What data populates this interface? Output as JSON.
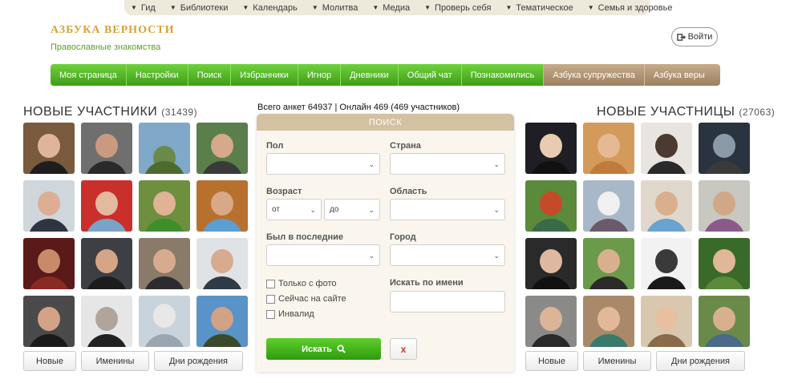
{
  "portal": {
    "items": [
      {
        "label": "Гид"
      },
      {
        "label": "Библиотеки"
      },
      {
        "label": "Календарь"
      },
      {
        "label": "Молитва"
      },
      {
        "label": "Медиа"
      },
      {
        "label": "Проверь себя"
      },
      {
        "label": "Тематическое"
      },
      {
        "label": "Семья и здоровье"
      }
    ]
  },
  "header": {
    "logo_title": "АЗБУКА ВЕРНОСТИ",
    "logo_subtitle": "Православные знакомства",
    "login_label": "Войти"
  },
  "nav": {
    "items": [
      {
        "label": "Моя страница"
      },
      {
        "label": "Настройки"
      },
      {
        "label": "Поиск"
      },
      {
        "label": "Избранники"
      },
      {
        "label": "Игнор"
      },
      {
        "label": "Дневники"
      },
      {
        "label": "Общий чат"
      },
      {
        "label": "Познакомились"
      },
      {
        "label": "Азбука супружества"
      },
      {
        "label": "Азбука веры"
      }
    ]
  },
  "men": {
    "title": "НОВЫЕ УЧАСТНИКИ",
    "count": "(31439)",
    "tabs": [
      "Новые",
      "Именины",
      "Дни рождения"
    ]
  },
  "women": {
    "title": "НОВЫЕ УЧАСТНИЦЫ",
    "count": "(27063)",
    "tabs": [
      "Новые",
      "Именины",
      "Дни рождения"
    ]
  },
  "stats": "Всего анкет 64937 | Онлайн 469 (469 участников)",
  "search": {
    "title": "ПОИСК",
    "gender_label": "Пол",
    "country_label": "Страна",
    "age_label": "Возраст",
    "age_from": "от",
    "age_to": "до",
    "region_label": "Область",
    "last_seen_label": "Был в последние",
    "city_label": "Город",
    "name_label": "Искать по имени",
    "checkboxes": [
      "Только с фото",
      "Сейчас на сайте",
      "Инвалид"
    ],
    "find_label": "Искать",
    "reset_label": "x"
  },
  "colors": {
    "nav_green": "#4caf1f",
    "nav_brown": "#b09574",
    "accent_gold": "#d8a13a",
    "panel_head": "#d3c1a2"
  }
}
